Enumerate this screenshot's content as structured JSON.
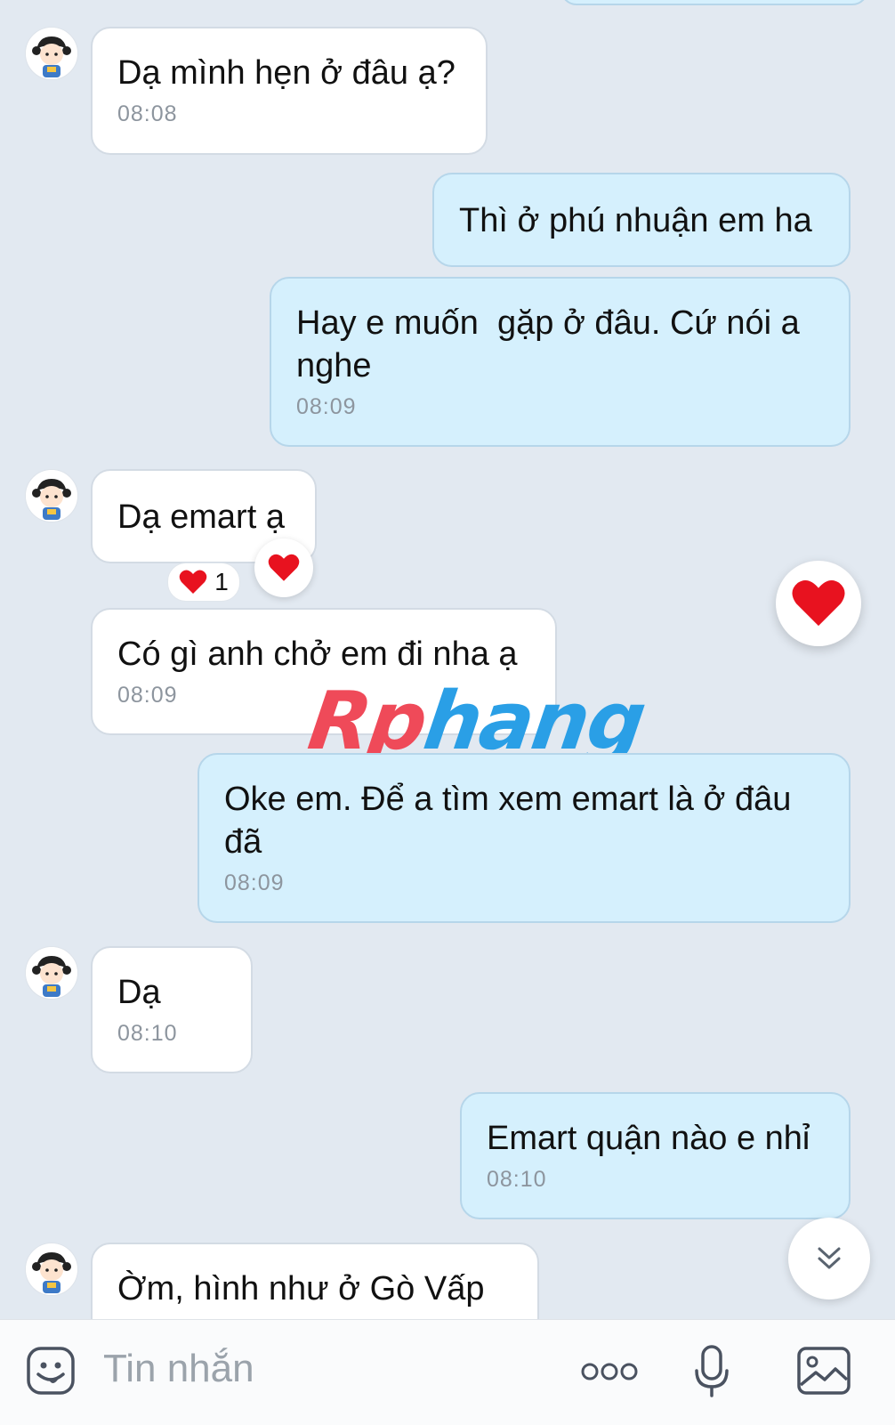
{
  "messages": [
    {
      "text": "Dạ mình hẹn ở đâu ạ?",
      "time": "08:08"
    },
    {
      "text": "Thì ở phú nhuận em ha"
    },
    {
      "text": "Hay e muốn  gặp ở đâu. Cứ nói a nghe",
      "time": "08:09"
    },
    {
      "text": "Dạ emart ạ",
      "reaction_count": "1"
    },
    {
      "text": "Có gì anh chở em đi nha ạ",
      "time": "08:09"
    },
    {
      "text": "Oke em. Để a tìm xem emart là ở đâu đã",
      "time": "08:09"
    },
    {
      "text": "Dạ",
      "time": "08:10"
    },
    {
      "text": "Emart quận nào e nhỉ",
      "time": "08:10"
    },
    {
      "text": "Ờm, hình như ở Gò Vấp ạ"
    }
  ],
  "watermark": {
    "part1": "Rp",
    "part2": "hang"
  },
  "composer": {
    "placeholder": "Tin nhắn"
  },
  "colors": {
    "incoming": "#ffffff",
    "outgoing": "#d5f0fd",
    "background": "#e2e9f1",
    "heart": "#e8121f"
  },
  "icons": [
    "avatar-girl",
    "heart",
    "chevron-double-down",
    "sticker-face",
    "more-dots",
    "microphone",
    "image"
  ]
}
